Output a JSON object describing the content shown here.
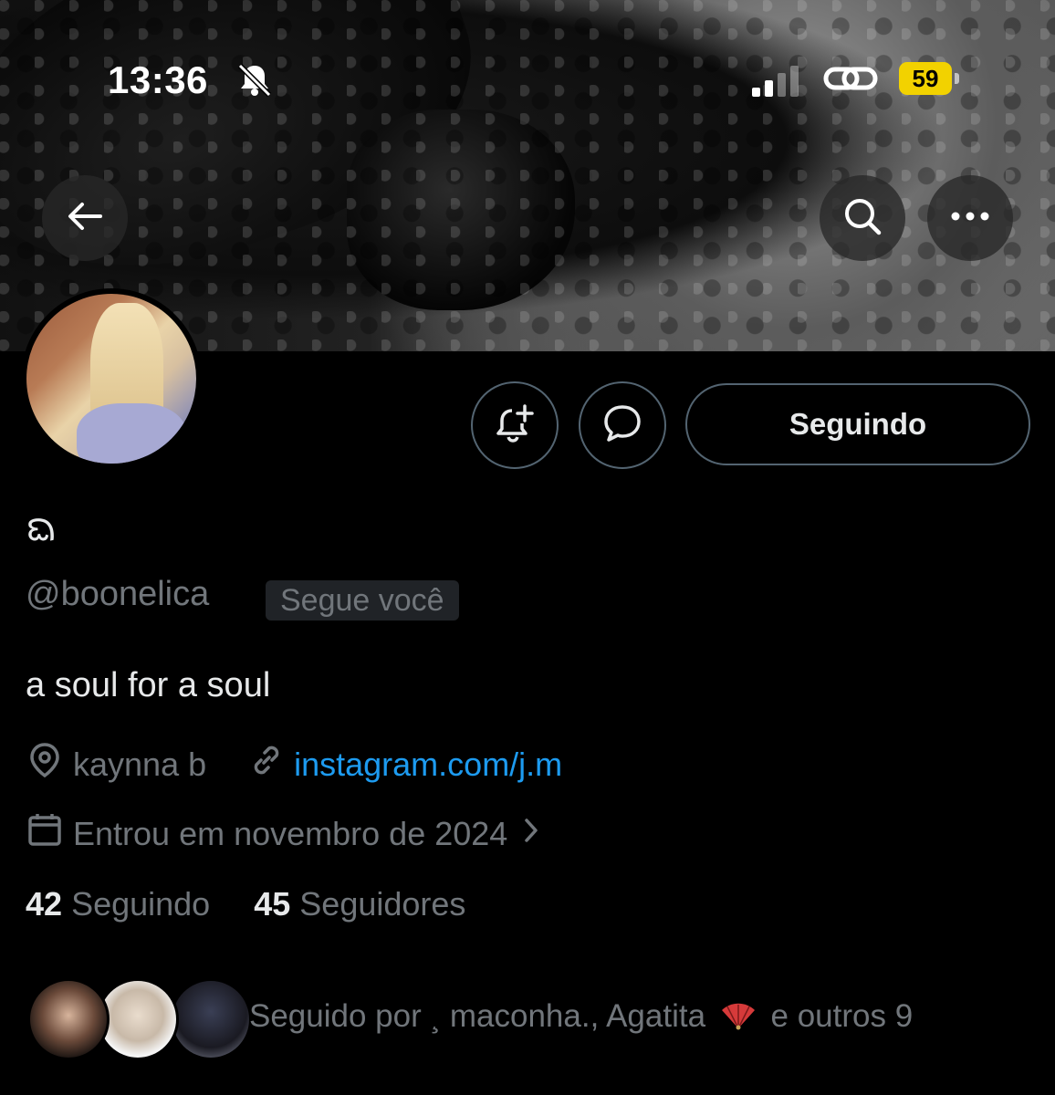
{
  "status_bar": {
    "time": "13:36",
    "battery": "59",
    "icons": [
      "bell-slash-icon",
      "signal-icon",
      "link-icon",
      "battery-icon"
    ]
  },
  "header": {
    "back_icon": "arrow-left-icon",
    "search_icon": "search-icon",
    "more_icon": "more-horizontal-icon"
  },
  "profile": {
    "display_name": "ᨳ",
    "handle": "@boonelica",
    "follows_you_badge": "Segue você",
    "bio": "a soul for a soul",
    "location": "kaynna b",
    "website": "instagram.com/j.m",
    "joined": "Entrou em novembro de 2024",
    "following_count": "42",
    "following_label": "Seguindo",
    "followers_count": "45",
    "followers_label": "Seguidores"
  },
  "actions": {
    "notify_icon": "bell-plus-icon",
    "message_icon": "chat-bubble-icon",
    "follow_button": "Seguindo"
  },
  "followed_by": {
    "prefix": "Seguido por ¸ maconha., Agatita",
    "suffix": "e outros 9"
  },
  "colors": {
    "accent_link": "#1d9bf0",
    "muted": "#71767b",
    "battery": "#f2d200",
    "background": "#000000"
  }
}
